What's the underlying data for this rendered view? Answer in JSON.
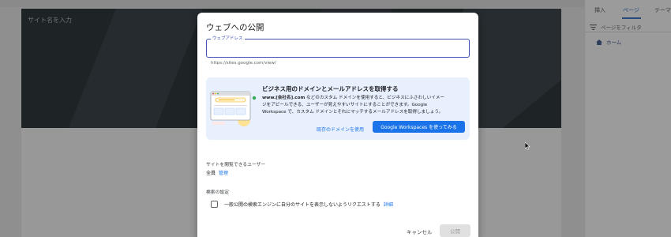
{
  "editor": {
    "site_name_placeholder": "サイト名を入力",
    "right_panel": {
      "tabs": [
        "挿入",
        "ページ",
        "テーマ"
      ],
      "active_tab": "ページ",
      "filter_label": "ページをフィルタ",
      "pages": [
        "ホーム"
      ]
    }
  },
  "dialog": {
    "title": "ウェブへの公開",
    "address_field": {
      "label": "ウェブアドレス",
      "value": "",
      "hint": "https://sites.google.com/view/"
    },
    "promo": {
      "title": "ビジネス用のドメインとメールアドレスを取得する",
      "body_bold": "www.[会社名].com",
      "body_line1": " などのカスタム ドメインを使用すると、ビジネスにふさわしいイメー",
      "body_line2": "ジをアピールできる、ユーザーが見えやすいサイトにすることができます。Google",
      "body_line3": "Workspace で、カスタム ドメインとそれにマッチするメールアドレスを取得しましょう。",
      "secondary_label": "既存のドメインを使用",
      "primary_label": "Google Workspaces を使ってみる"
    },
    "viewers": {
      "label": "サイトを閲覧できるユーザー",
      "value": "全員",
      "manage_label": "管理"
    },
    "search": {
      "label": "検索の設定",
      "checkbox_checked": false,
      "checkbox_label": "一般公開の検索エンジンに自分のサイトを表示しないようリクエストする",
      "details_label": "詳細"
    },
    "footer": {
      "cancel_label": "キャンセル",
      "publish_label": "公開"
    }
  },
  "colors": {
    "accent": "#1a73e8",
    "field_focus": "#3f51b5",
    "promo_bg": "#e8f0fe"
  }
}
